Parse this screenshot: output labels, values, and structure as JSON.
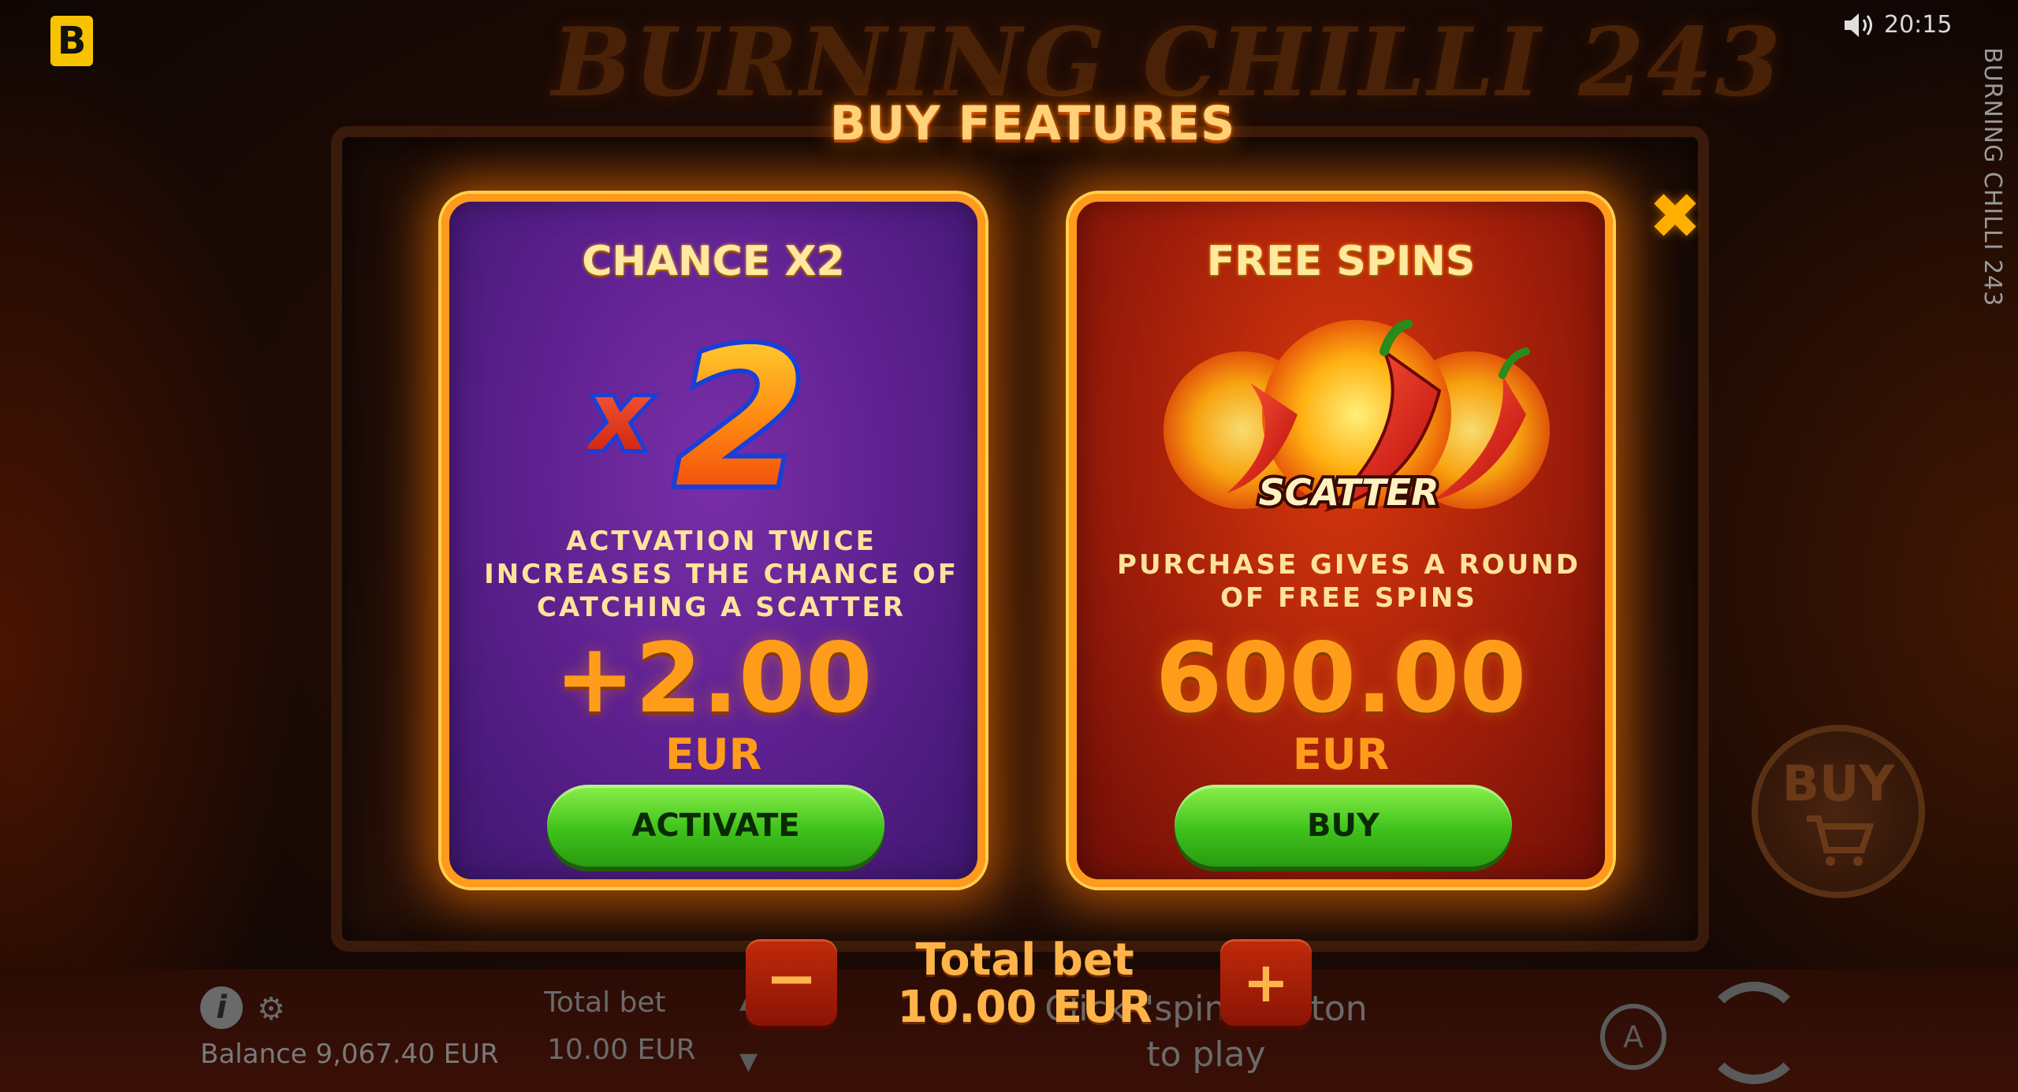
{
  "top_bar": {
    "brand_logo": "B",
    "clock": "20:15",
    "side_title": "BURNING CHILLI 243",
    "background_logo": "BURNING CHILLI 243"
  },
  "header": {
    "title": "BUY FEATURES",
    "close_symbol": "✖"
  },
  "cards": [
    {
      "title": "CHANCE X2",
      "graphic_label": "x2",
      "description": "ACTVATION TWICE INCREASES THE CHANCE OF CATCHING A SCATTER",
      "price": "+2.00",
      "currency": "EUR",
      "button_label": "ACTIVATE",
      "theme_color": "#5a1f8c"
    },
    {
      "title": "FREE SPINS",
      "graphic_label": "SCATTER",
      "description": "PURCHASE GIVES A ROUND OF FREE SPINS",
      "price": "600.00",
      "currency": "EUR",
      "button_label": "BUY",
      "theme_color": "#a11e0a"
    }
  ],
  "bet_control": {
    "label": "Total bet",
    "value": "10.00 EUR",
    "minus_symbol": "−",
    "plus_symbol": "+"
  },
  "bottom_bar": {
    "info_symbol": "i",
    "gear_symbol": "⚙",
    "balance": "Balance 9,067.40 EUR",
    "bet_label": "Total bet",
    "bet_value": "10.00 EUR",
    "hint_line1": "Click \"spin\" button",
    "hint_line2": "to play",
    "auto_symbol": "A",
    "side_buy_label": "BUY"
  },
  "colors": {
    "accent_orange": "#ff9d1a",
    "button_green": "#3fc21c",
    "brand_yellow": "#f7c300"
  }
}
